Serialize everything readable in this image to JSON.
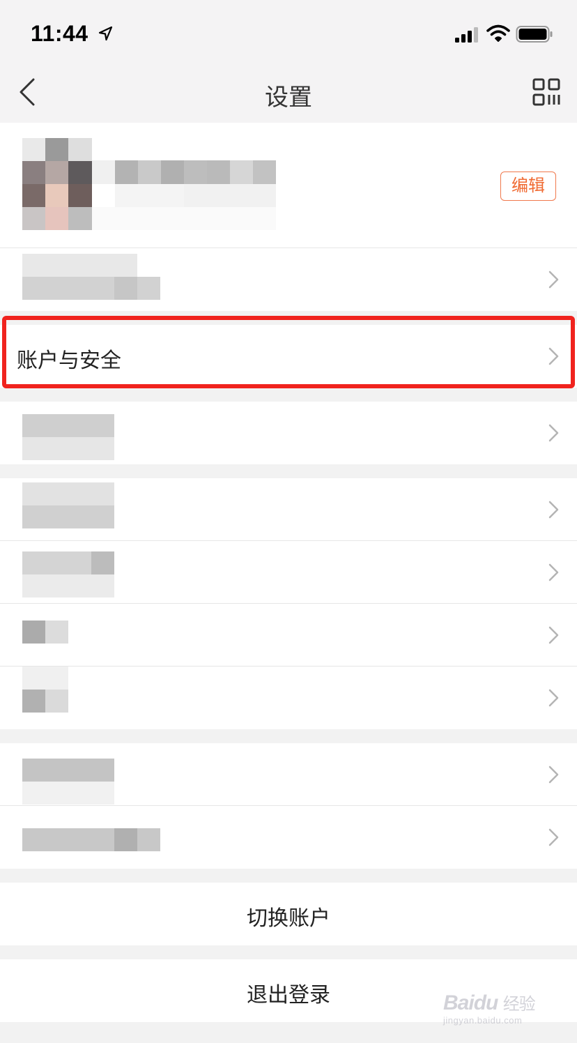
{
  "status_bar": {
    "time": "11:44",
    "icons": [
      "location-arrow-icon",
      "cellular-signal-icon",
      "wifi-icon",
      "battery-icon"
    ]
  },
  "nav": {
    "title": "设置",
    "back_icon": "chevron-left-icon",
    "right_icon": "qr-code-icon"
  },
  "profile": {
    "edit_label": "编辑"
  },
  "menu": {
    "account_security_label": "账户与安全"
  },
  "actions": {
    "switch_account": "切换账户",
    "logout": "退出登录"
  },
  "watermark": {
    "brand": "Bai",
    "brand_cn": "经验",
    "url": "jingyan.baidu.com"
  },
  "colors": {
    "accent": "#f06a32",
    "highlight": "#f0231e",
    "background": "#f2f2f2"
  }
}
